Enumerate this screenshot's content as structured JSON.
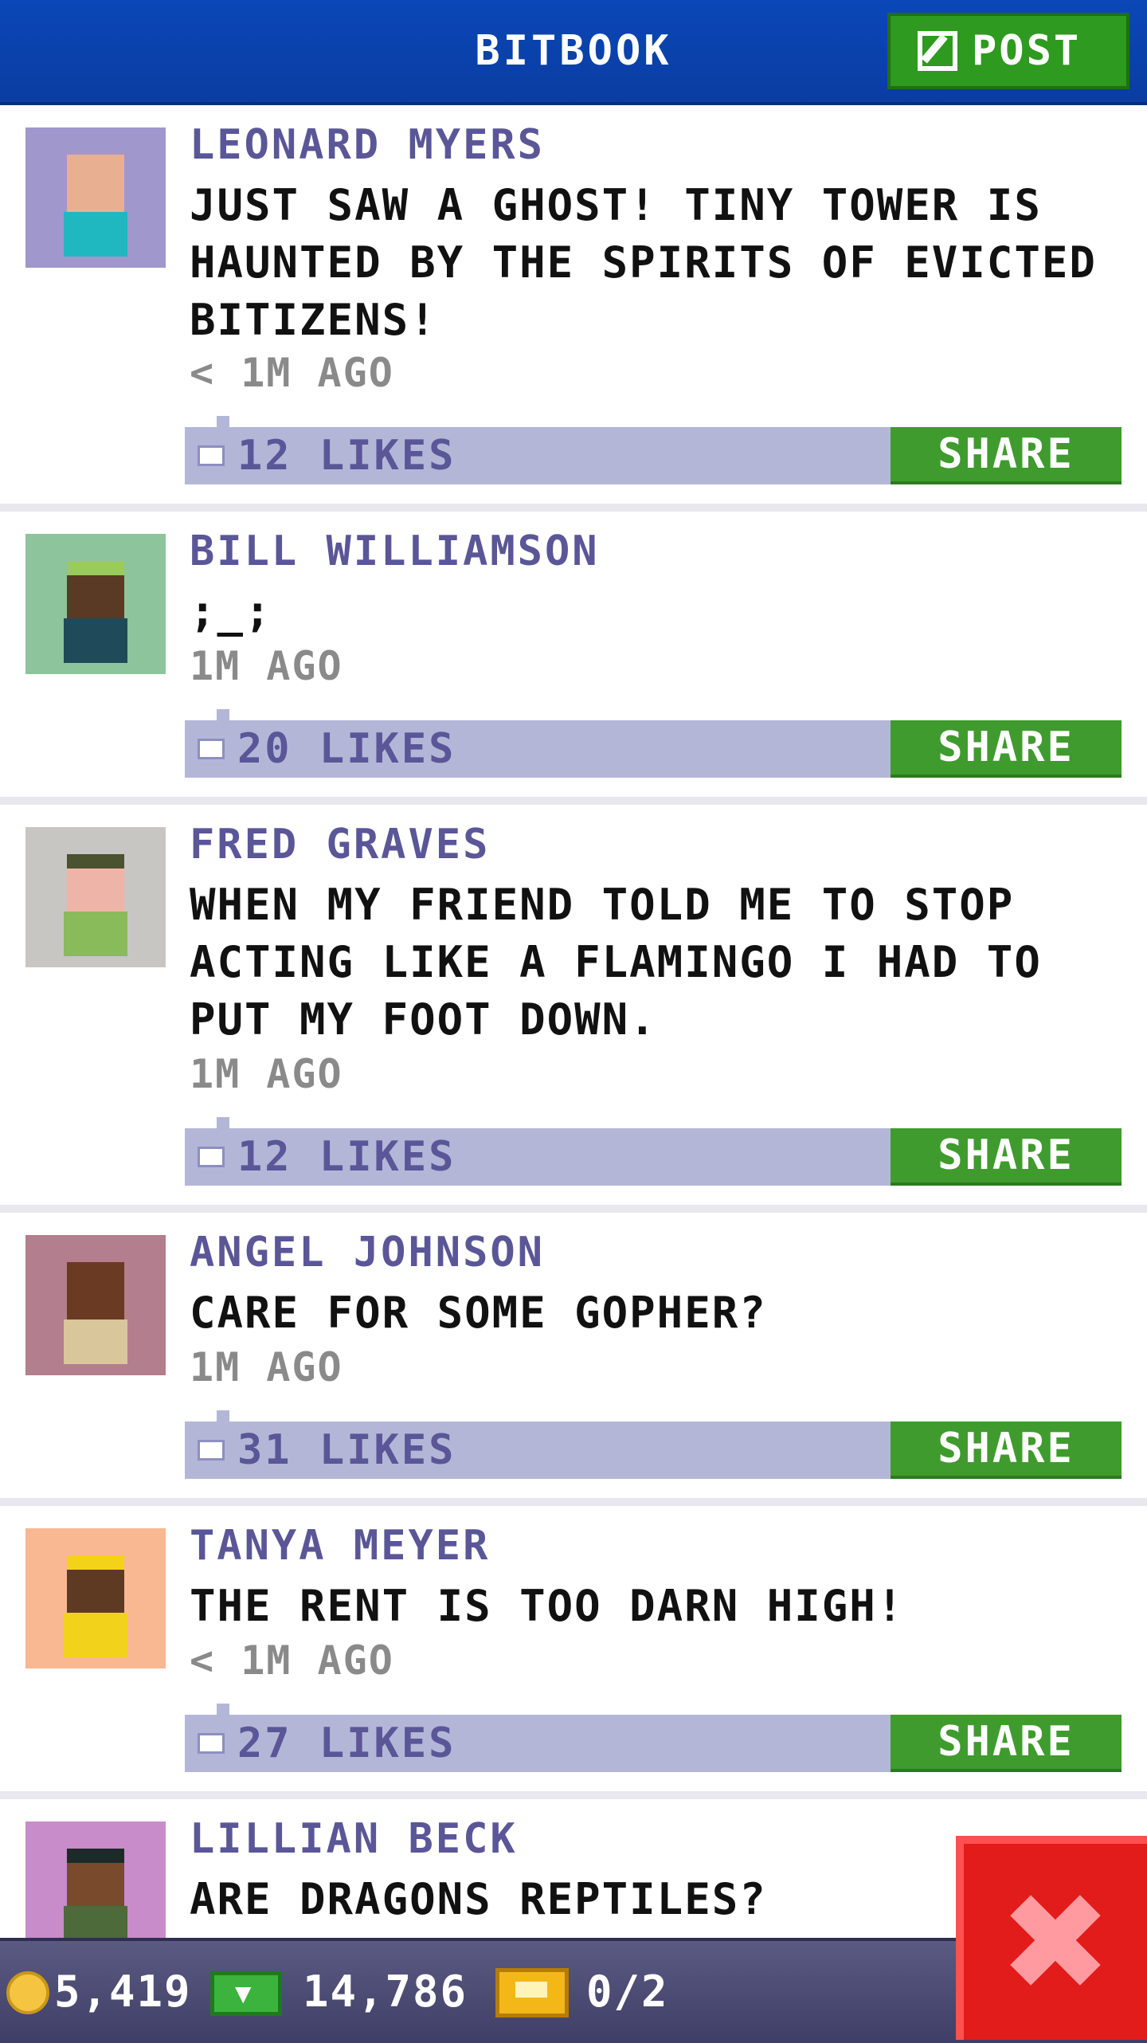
{
  "header": {
    "title": "BITBOOK",
    "post_label": "POST"
  },
  "posts": [
    {
      "name": "LEONARD MYERS",
      "message": "JUST SAW A GHOST! TINY TOWER IS HAUNTED BY THE SPIRITS OF EVICTED BITIZENS!",
      "time": "< 1M AGO",
      "likes": "12 LIKES",
      "share": "SHARE"
    },
    {
      "name": "BILL WILLIAMSON",
      "message": ";_;",
      "time": "1M AGO",
      "likes": "20 LIKES",
      "share": "SHARE"
    },
    {
      "name": "FRED GRAVES",
      "message": "WHEN MY FRIEND TOLD ME TO STOP ACTING LIKE A FLAMINGO I HAD TO PUT MY FOOT DOWN.",
      "time": "1M AGO",
      "likes": "12 LIKES",
      "share": "SHARE"
    },
    {
      "name": "ANGEL JOHNSON",
      "message": "CARE FOR SOME GOPHER?",
      "time": "1M AGO",
      "likes": "31 LIKES",
      "share": "SHARE"
    },
    {
      "name": "TANYA MEYER",
      "message": "THE RENT IS TOO DARN HIGH!",
      "time": "< 1M AGO",
      "likes": "27 LIKES",
      "share": "SHARE"
    },
    {
      "name": "LILLIAN BECK",
      "message": "ARE DRAGONS REPTILES?"
    }
  ],
  "status": {
    "coins": "5,419",
    "bux": "14,786",
    "tickets": "0/2"
  },
  "colors": {
    "header": "#0a3da1",
    "name": "#5a5697",
    "like_bar": "#b4b6d8",
    "share": "#3f9b2d",
    "close": "#e21b1b"
  },
  "icons": {
    "post": "edit-icon",
    "like": "thumbs-up-icon",
    "coin": "coin-icon",
    "bux": "bux-icon",
    "ticket": "ticket-icon",
    "close": "close-icon"
  }
}
